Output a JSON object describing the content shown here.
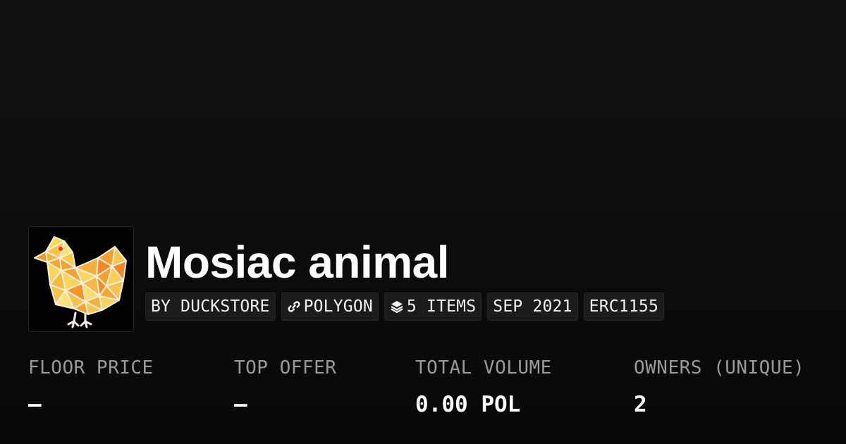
{
  "collection": {
    "name": "Mosiac animal",
    "avatar_icon": "mosaic-chick-icon"
  },
  "tags": {
    "creator": "BY DUCKSTORE",
    "chain": "POLYGON",
    "chain_icon": "polygon-link-icon",
    "items": "5 ITEMS",
    "items_icon": "layers-icon",
    "date": "SEP 2021",
    "standard": "ERC1155"
  },
  "stats": {
    "floor_price": {
      "label": "FLOOR PRICE",
      "value": "–"
    },
    "top_offer": {
      "label": "TOP OFFER",
      "value": "–"
    },
    "total_volume": {
      "label": "TOTAL VOLUME",
      "value": "0.00 POL"
    },
    "owners": {
      "label": "OWNERS (UNIQUE)",
      "value": "2"
    }
  },
  "colors": {
    "background": "#0b0b0b",
    "tag_background": "#1b1b1b",
    "label_gray": "#9a9a9a",
    "text_white": "#ffffff"
  }
}
